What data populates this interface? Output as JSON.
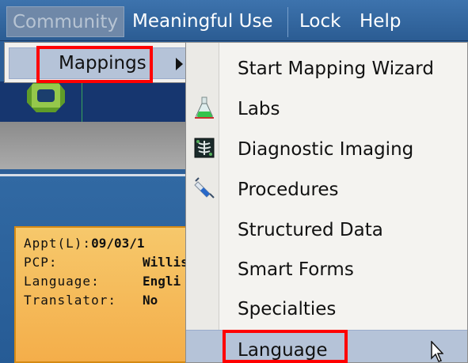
{
  "menubar": {
    "items": [
      {
        "label": "Community",
        "state": "open"
      },
      {
        "label": "Meaningful Use"
      },
      {
        "label": "Lock"
      },
      {
        "label": "Help"
      }
    ]
  },
  "community_menu": {
    "items": [
      {
        "label": "Mappings",
        "has_submenu": true,
        "state": "highlighted"
      }
    ]
  },
  "mappings_submenu": {
    "items": [
      {
        "label": "Start Mapping Wizard",
        "icon": "none"
      },
      {
        "label": "Labs",
        "icon": "flask-icon"
      },
      {
        "label": "Diagnostic Imaging",
        "icon": "xray-icon"
      },
      {
        "label": "Procedures",
        "icon": "syringe-icon"
      },
      {
        "label": "Structured Data",
        "icon": "none"
      },
      {
        "label": "Smart Forms",
        "icon": "none"
      },
      {
        "label": "Specialties",
        "icon": "none"
      },
      {
        "label": "Language",
        "icon": "none",
        "state": "highlighted"
      }
    ]
  },
  "patient_card": {
    "appt_label": "Appt(L):",
    "appt_value": "09/03/1",
    "pcp_label": "PCP:",
    "pcp_value": "Willis",
    "language_label": "Language:",
    "language_value": "Engli",
    "translator_label": "Translator:",
    "translator_value": "No"
  },
  "colors": {
    "menubar": "#2b5c93",
    "highlight": "#b5c3d8",
    "annotation": "#ff0000",
    "patient_card": "#f4ae4a"
  }
}
